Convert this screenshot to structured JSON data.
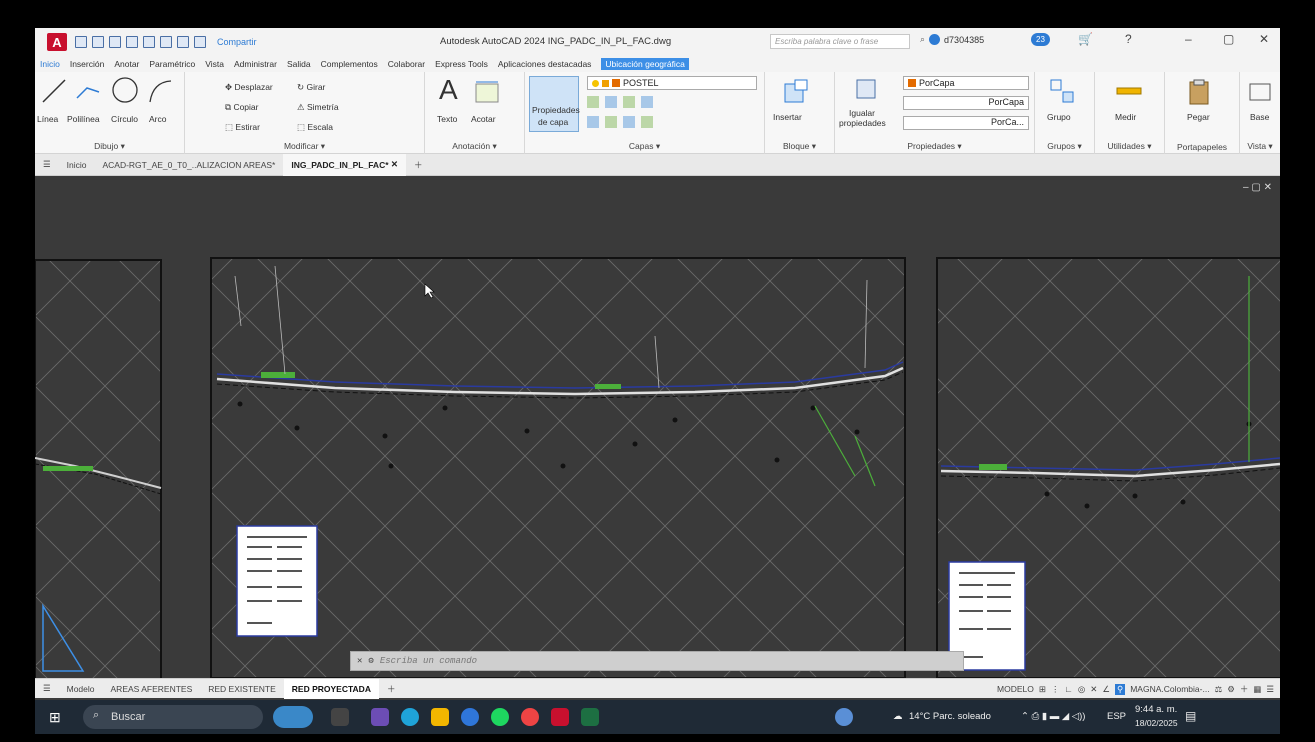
{
  "titlebar": {
    "share_label": "Compartir",
    "window_title": "Autodesk AutoCAD 2024   ING_PADC_IN_PL_FAC.dwg",
    "search_placeholder": "Escriba palabra clave o frase",
    "username": "d7304385",
    "notifications": "23"
  },
  "ribbon_tabs": [
    "Inicio",
    "Inserción",
    "Anotar",
    "Paramétrico",
    "Vista",
    "Administrar",
    "Salida",
    "Complementos",
    "Colaborar",
    "Express Tools",
    "Aplicaciones destacadas",
    "Ubicación geográfica"
  ],
  "ribbon": {
    "draw": {
      "linea": "Línea",
      "polilinea": "Polilínea",
      "circulo": "Círculo",
      "arco": "Arco",
      "title": "Dibujo ▾"
    },
    "modify": {
      "desplazar": "Desplazar",
      "girar": "Girar",
      "copiar": "Copiar",
      "simetria": "Simetría",
      "estirar": "Estirar",
      "escala": "Escala",
      "title": "Modificar ▾"
    },
    "annotation": {
      "texto": "Texto",
      "acotar": "Acotar",
      "title": "Anotación ▾"
    },
    "layers": {
      "propiedades": "Propiedades",
      "de_capa": "de capa",
      "current_layer": "POSTEL",
      "title": "Capas ▾"
    },
    "block": {
      "insertar": "Insertar",
      "title": "Bloque ▾"
    },
    "properties": {
      "igualar": "Igualar",
      "propiedades": "propiedades",
      "porcapa1": "PorCapa",
      "porcapa2": "PorCapa",
      "porcapa3": "PorCa...",
      "title": "Propiedades ▾"
    },
    "groups": {
      "grupo": "Grupo",
      "title": "Grupos ▾"
    },
    "utilities": {
      "medir": "Medir",
      "title": "Utilidades ▾"
    },
    "clipboard": {
      "pegar": "Pegar",
      "title": "Portapapeles"
    },
    "view": {
      "base": "Base",
      "title": "Vista ▾"
    }
  },
  "doc_tabs": {
    "home": "Inicio",
    "tab1": "ACAD-RGT_AE_0_T0_..ALIZACION AREAS*",
    "tab2": "ING_PADC_IN_PL_FAC*"
  },
  "command_placeholder": "Escriba un comando",
  "layout_tabs": [
    "Modelo",
    "AREAS AFERENTES",
    "RED EXISTENTE",
    "RED PROYECTADA"
  ],
  "status": {
    "model": "MODELO",
    "coords": "MAGNA.Colombia-..."
  },
  "taskbar": {
    "search": "Buscar",
    "weather": "14°C  Parc. soleado",
    "lang": "ESP",
    "time": "9:44 a. m.",
    "date": "18/02/2025"
  },
  "colors": {
    "accent": "#2d7bd4",
    "autocad_red": "#c8102e",
    "canvas": "#3a3a3a"
  }
}
